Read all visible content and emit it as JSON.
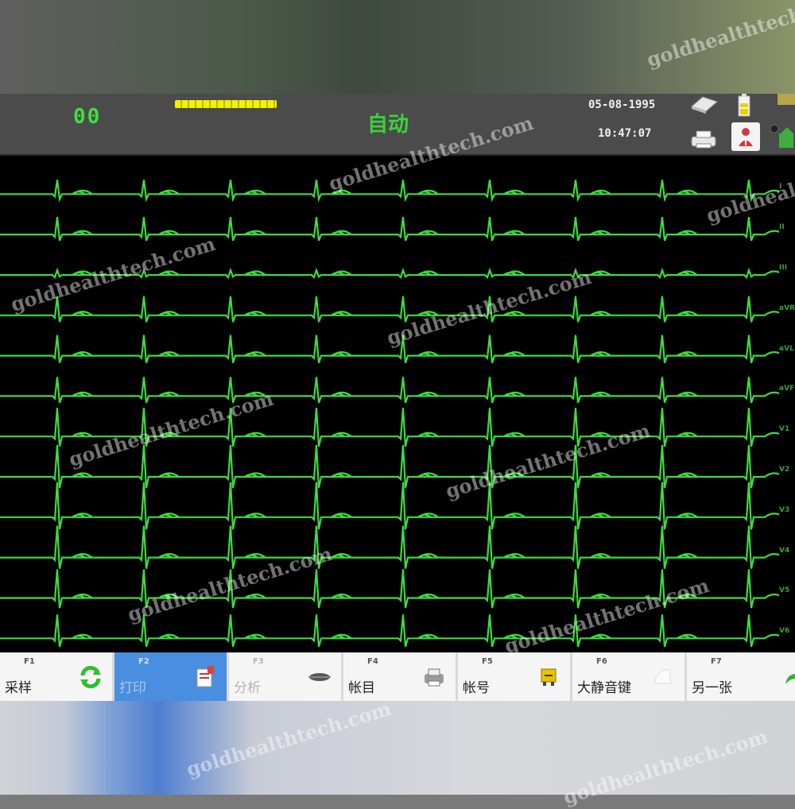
{
  "status_bar": {
    "heart_rate": "00",
    "mode_title": "自动",
    "date": "05-08-1995",
    "time": "10:47:07"
  },
  "lead_labels": [
    "I",
    "II",
    "III",
    "aVR",
    "aVL",
    "aVF",
    "V1",
    "V2",
    "V3",
    "V4",
    "V5",
    "V6"
  ],
  "toolbar": {
    "buttons": [
      {
        "key": "F1",
        "label": "采样",
        "icon": "refresh-icon"
      },
      {
        "key": "F2",
        "label": "打印",
        "icon": "print-report-icon"
      },
      {
        "key": "F3",
        "label": "分析",
        "icon": "analysis-icon"
      },
      {
        "key": "F4",
        "label": "帐目",
        "icon": "record-icon"
      },
      {
        "key": "F5",
        "label": "帐号",
        "icon": "folder-icon"
      },
      {
        "key": "F6",
        "label": "大静音键",
        "icon": "mute-icon"
      },
      {
        "key": "F7",
        "label": "另一张",
        "icon": "next-arrow-icon"
      }
    ]
  },
  "watermark_text": "goldhealthtech.com",
  "colors": {
    "trace": "#3ddc3d",
    "screen_bg": "#000000",
    "status_bg": "#4b4b4b",
    "active_button": "#4a8ee0"
  }
}
